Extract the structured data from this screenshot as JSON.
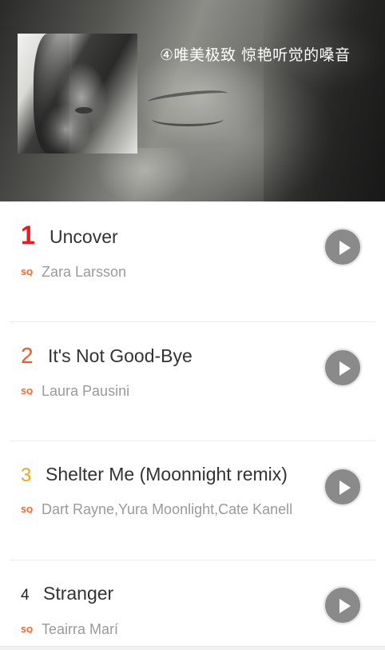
{
  "banner": {
    "title": "④唯美极致 惊艳听觉的嗓音"
  },
  "songs": [
    {
      "rank": "1",
      "title": "Uncover",
      "quality": "SQ",
      "artist": "Zara Larsson",
      "rank_color": "#f2161c"
    },
    {
      "rank": "2",
      "title": "It's Not Good-Bye",
      "quality": "SQ",
      "artist": "Laura Pausini",
      "rank_color": "#f25a2b"
    },
    {
      "rank": "3",
      "title": "Shelter Me (Moonnight remix)",
      "quality": "SQ",
      "artist": "Dart Rayne,Yura Moonlight,Cate Kanell",
      "rank_color": "#f5a21c"
    },
    {
      "rank": "4",
      "title": "Stranger",
      "quality": "SQ",
      "artist": "Teairra Marí",
      "rank_color": "#222222"
    }
  ],
  "colors": {
    "sq_badge": "#ff6a2f",
    "play_button": "#8a8a8a",
    "artist_text": "#9a9a9a"
  },
  "icons": {
    "play": "play-icon",
    "quality": "sq-quality-icon"
  }
}
